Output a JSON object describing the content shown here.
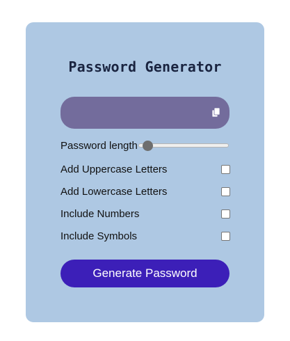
{
  "app": {
    "title": "Password Generator"
  },
  "output": {
    "value": "",
    "copy_icon": "copy-icon"
  },
  "length": {
    "label": "Password length",
    "slider_fraction": 0.05
  },
  "options": [
    {
      "label": "Add Uppercase Letters",
      "checked": false
    },
    {
      "label": "Add Lowercase Letters",
      "checked": false
    },
    {
      "label": "Include Numbers",
      "checked": false
    },
    {
      "label": "Include Symbols",
      "checked": false
    }
  ],
  "actions": {
    "generate_label": "Generate Password"
  },
  "colors": {
    "card_bg": "#aec8e3",
    "output_bg": "#736c9c",
    "button_bg": "#3c1fb8"
  }
}
